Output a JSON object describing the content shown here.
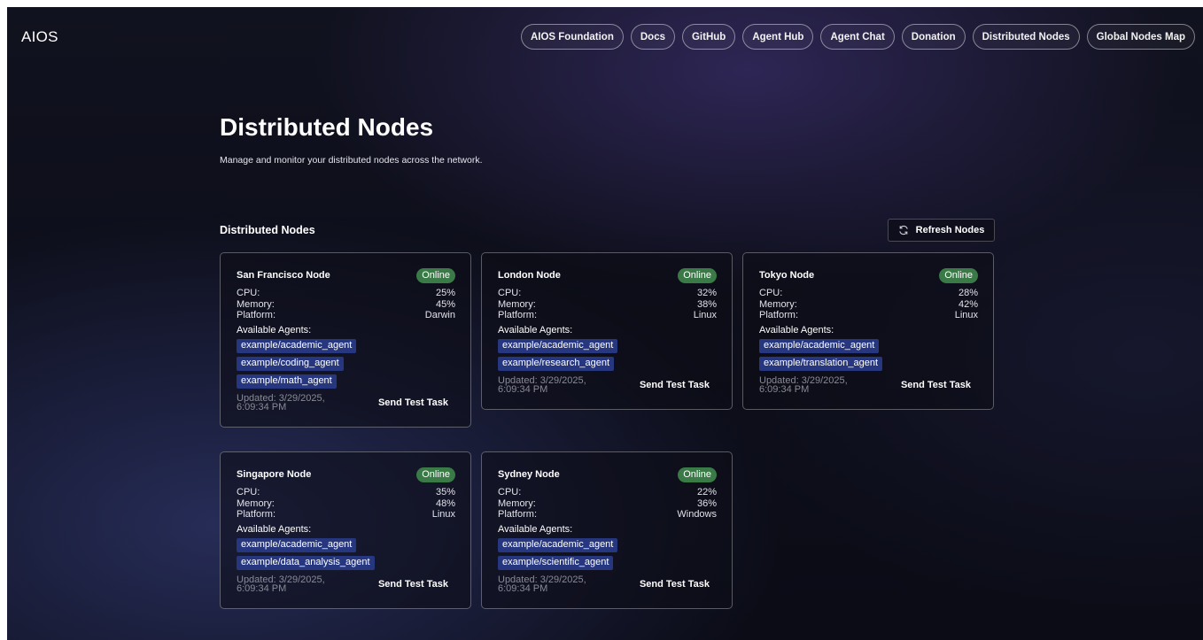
{
  "brand": "AIOS",
  "nav": [
    {
      "label": "AIOS Foundation"
    },
    {
      "label": "Docs"
    },
    {
      "label": "GitHub"
    },
    {
      "label": "Agent Hub"
    },
    {
      "label": "Agent Chat"
    },
    {
      "label": "Donation"
    },
    {
      "label": "Distributed Nodes"
    },
    {
      "label": "Global Nodes Map"
    }
  ],
  "page": {
    "title": "Distributed Nodes",
    "subtitle": "Manage and monitor your distributed nodes across the network."
  },
  "section": {
    "title": "Distributed Nodes",
    "refresh_label": "Refresh Nodes",
    "refresh_icon": "refresh-icon"
  },
  "labels": {
    "cpu": "CPU:",
    "memory": "Memory:",
    "platform": "Platform:",
    "available_agents": "Available Agents:",
    "send_test_task": "Send Test Task"
  },
  "status_color": "#3a7a47",
  "agent_chip_color": "#26377f",
  "nodes": [
    {
      "name": "San Francisco Node",
      "status": "Online",
      "cpu": "25%",
      "memory": "45%",
      "platform": "Darwin",
      "agents": [
        "example/academic_agent",
        "example/coding_agent",
        "example/math_agent"
      ],
      "updated_line1": "Updated: 3/29/2025,",
      "updated_line2": "6:09:34 PM"
    },
    {
      "name": "London Node",
      "status": "Online",
      "cpu": "32%",
      "memory": "38%",
      "platform": "Linux",
      "agents": [
        "example/academic_agent",
        "example/research_agent"
      ],
      "updated_line1": "Updated: 3/29/2025,",
      "updated_line2": "6:09:34 PM"
    },
    {
      "name": "Tokyo Node",
      "status": "Online",
      "cpu": "28%",
      "memory": "42%",
      "platform": "Linux",
      "agents": [
        "example/academic_agent",
        "example/translation_agent"
      ],
      "updated_line1": "Updated: 3/29/2025,",
      "updated_line2": "6:09:34 PM"
    },
    {
      "name": "Singapore Node",
      "status": "Online",
      "cpu": "35%",
      "memory": "48%",
      "platform": "Linux",
      "agents": [
        "example/academic_agent",
        "example/data_analysis_agent"
      ],
      "updated_line1": "Updated: 3/29/2025,",
      "updated_line2": "6:09:34 PM"
    },
    {
      "name": "Sydney Node",
      "status": "Online",
      "cpu": "22%",
      "memory": "36%",
      "platform": "Windows",
      "agents": [
        "example/academic_agent",
        "example/scientific_agent"
      ],
      "updated_line1": "Updated: 3/29/2025,",
      "updated_line2": "6:09:34 PM"
    }
  ]
}
